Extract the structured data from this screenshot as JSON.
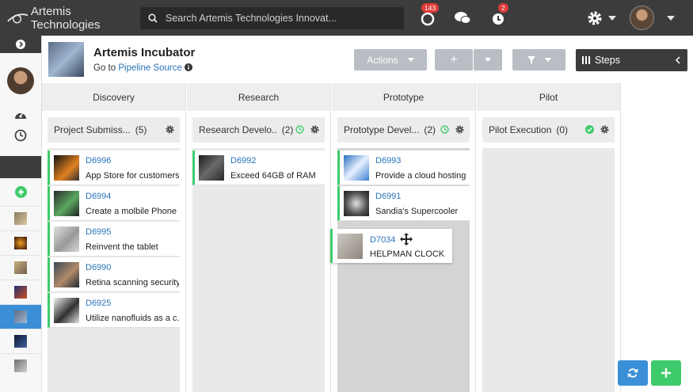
{
  "app": {
    "brand": "Artemis Technologies"
  },
  "search": {
    "placeholder": "Search Artemis Technologies Innovat..."
  },
  "topbar": {
    "notifications_count": "143",
    "alerts_count": "2"
  },
  "header": {
    "title": "Artemis Incubator",
    "go_to": "Go to",
    "pipeline_link": "Pipeline Source",
    "actions_label": "Actions",
    "add_label": "+",
    "steps_label": "Steps"
  },
  "columns": [
    {
      "name": "Discovery",
      "lane": "Project Submiss...",
      "count": "(5)",
      "cards": [
        {
          "id": "D6996",
          "title": "App Store for customers"
        },
        {
          "id": "D6994",
          "title": "Create a molbile Phone"
        },
        {
          "id": "D6995",
          "title": "Reinvent the tablet"
        },
        {
          "id": "D6990",
          "title": "Retina scanning security"
        },
        {
          "id": "D6925",
          "title": "Utilize nanofluids as a c..."
        }
      ]
    },
    {
      "name": "Research",
      "lane": "Research Develo..",
      "count": "(2)",
      "cards": [
        {
          "id": "D6992",
          "title": "Exceed 64GB of RAM"
        }
      ]
    },
    {
      "name": "Prototype",
      "lane": "Prototype Devel...",
      "count": "(2)",
      "cards": [
        {
          "id": "D6993",
          "title": "Provide a cloud hosting ..."
        },
        {
          "id": "D6991",
          "title": "Sandia's Supercooler"
        }
      ]
    },
    {
      "name": "Pilot",
      "lane": "Pilot Execution",
      "count": "(0)",
      "cards": []
    }
  ],
  "dragging_card": {
    "id": "D7034",
    "title": "HELPMAN CLOCK"
  },
  "colors": {
    "accent_green": "#3ecb6b",
    "link_blue": "#2a74b8",
    "topbar": "#3c3c3c",
    "refresh_blue": "#3b8fd6",
    "add_green": "#3ecb6b"
  },
  "icons": [
    "search-icon",
    "notifications-icon",
    "chat-icon",
    "alerts-icon",
    "gear-icon",
    "dashboard-icon",
    "clock-icon",
    "add-icon",
    "refresh-icon",
    "move-icon",
    "filter-icon"
  ]
}
